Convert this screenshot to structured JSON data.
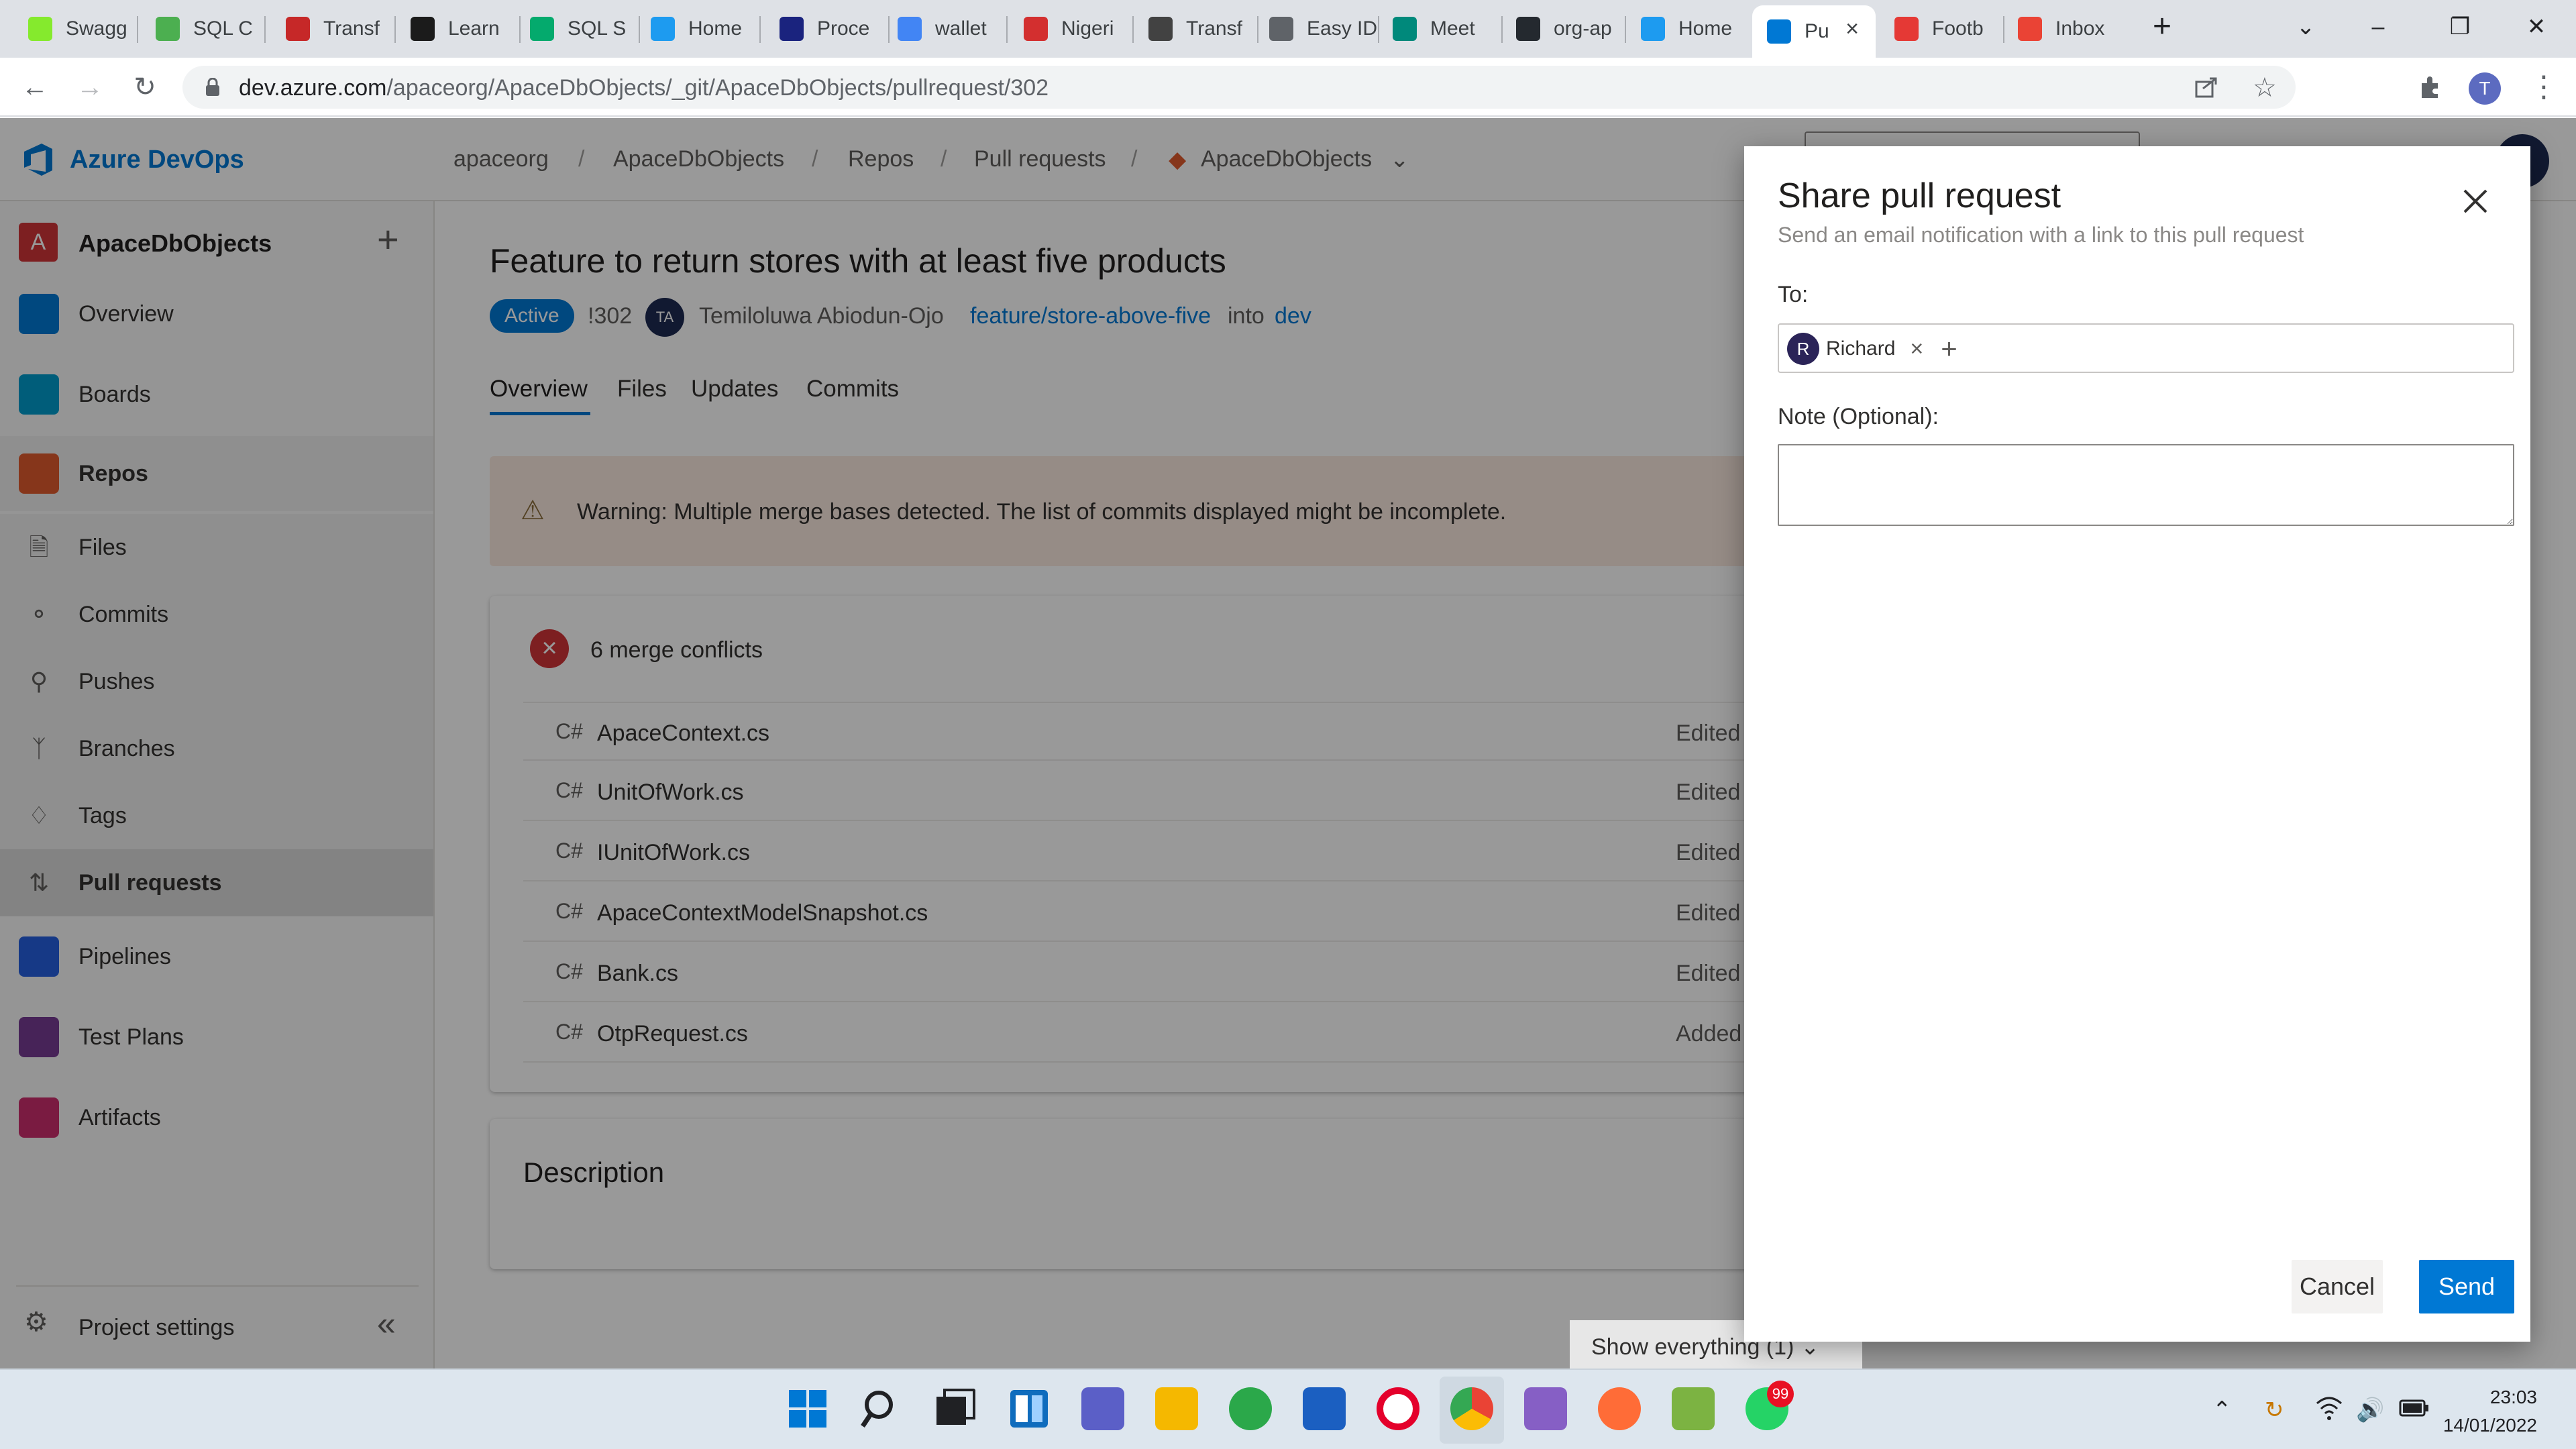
{
  "browser": {
    "tabs": [
      {
        "title": "Swagg",
        "icon": "swagger-icon",
        "color": "#85ea2d"
      },
      {
        "title": "SQL C",
        "icon": "sql-icon",
        "color": "#4caf50"
      },
      {
        "title": "Transf",
        "icon": "transfer-icon",
        "color": "#c62828"
      },
      {
        "title": "Learn",
        "icon": "learn-icon",
        "color": "#1b1b1b"
      },
      {
        "title": "SQL S",
        "icon": "w3schools-icon",
        "color": "#04aa6d"
      },
      {
        "title": "Home",
        "icon": "twitter-icon",
        "color": "#1d9bf0"
      },
      {
        "title": "Proce",
        "icon": "proce-icon",
        "color": "#1a237e"
      },
      {
        "title": "wallet",
        "icon": "google-icon",
        "color": "#4285f4"
      },
      {
        "title": "Nigeri",
        "icon": "news-icon",
        "color": "#d32f2f"
      },
      {
        "title": "Transf",
        "icon": "transfer2-icon",
        "color": "#424242"
      },
      {
        "title": "Easy ID",
        "icon": "globe-icon",
        "color": "#5f6368"
      },
      {
        "title": "Meet",
        "icon": "meet-icon",
        "color": "#00897b"
      },
      {
        "title": "org-ap",
        "icon": "github-icon",
        "color": "#24292f"
      },
      {
        "title": "Home",
        "icon": "twitter-icon",
        "color": "#1d9bf0"
      },
      {
        "title": "Pu",
        "icon": "azure-devops-icon",
        "color": "#0078d4"
      },
      {
        "title": "Footb",
        "icon": "football-icon",
        "color": "#e53935"
      },
      {
        "title": "Inbox",
        "icon": "gmail-icon",
        "color": "#ea4335"
      }
    ],
    "active_tab": 14,
    "new_tab": "+",
    "url_host": "dev.azure.com",
    "url_path": "/apaceorg/ApaceDbObjects/_git/ApaceDbObjects/pullrequest/302",
    "profile_initial": "T"
  },
  "devops": {
    "brand": "Azure DevOps",
    "breadcrumbs": [
      "apaceorg",
      "ApaceDbObjects",
      "Repos",
      "Pull requests",
      "ApaceDbObjects"
    ],
    "project": {
      "initial": "A",
      "name": "ApaceDbObjects"
    },
    "nav": [
      {
        "label": "Overview",
        "color": "#0078d4"
      },
      {
        "label": "Boards",
        "color": "#009ccc"
      },
      {
        "label": "Repos",
        "color": "#e05b2e"
      },
      {
        "label": "Pipelines",
        "color": "#2560e0"
      },
      {
        "label": "Test Plans",
        "color": "#773b93"
      },
      {
        "label": "Artifacts",
        "color": "#cb2e6d"
      }
    ],
    "subnav": [
      "Files",
      "Commits",
      "Pushes",
      "Branches",
      "Tags",
      "Pull requests"
    ],
    "settings": "Project settings",
    "pr": {
      "title": "Feature to return stores with at least five products",
      "status": "Active",
      "id": "!302",
      "author_initials": "TA",
      "author": "Temiloluwa Abiodun-Ojo",
      "source_branch": "feature/store-above-five",
      "into": "into",
      "target_branch": "dev",
      "tabs": [
        "Overview",
        "Files",
        "Updates",
        "Commits"
      ],
      "warning": "Warning: Multiple merge bases detected. The list of commits displayed might be incomplete.",
      "conflicts_title": "6 merge conflicts",
      "files": [
        {
          "lang": "C#",
          "name": "ApaceContext.cs",
          "status": "Edited i"
        },
        {
          "lang": "C#",
          "name": "UnitOfWork.cs",
          "status": "Edited i"
        },
        {
          "lang": "C#",
          "name": "IUnitOfWork.cs",
          "status": "Edited i"
        },
        {
          "lang": "C#",
          "name": "ApaceContextModelSnapshot.cs",
          "status": "Edited i"
        },
        {
          "lang": "C#",
          "name": "Bank.cs",
          "status": "Edited i"
        },
        {
          "lang": "C#",
          "name": "OtpRequest.cs",
          "status": "Added i"
        }
      ],
      "description_label": "Description",
      "show_filter": "Show everything (1)"
    }
  },
  "dialog": {
    "title": "Share pull request",
    "subtitle": "Send an email notification with a link to this pull request",
    "to_label": "To:",
    "recipient": {
      "initial": "R",
      "name": "Richard"
    },
    "note_label": "Note (Optional):",
    "note_value": "",
    "cancel": "Cancel",
    "send": "Send"
  },
  "taskbar": {
    "whatsapp_badge": "99",
    "time": "23:03",
    "date": "14/01/2022"
  }
}
